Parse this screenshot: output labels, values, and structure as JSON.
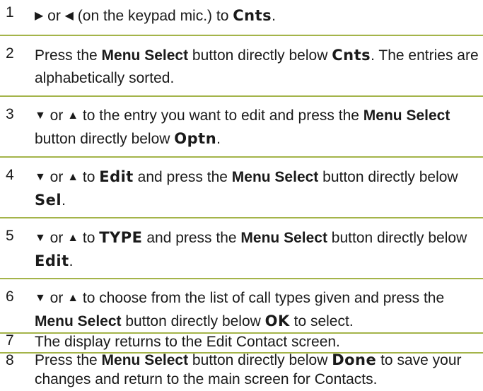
{
  "steps": [
    {
      "num": "1",
      "seg": [
        "▶",
        " or ",
        "◀",
        " (on the keypad mic.) to ",
        "Cnts",
        "."
      ]
    },
    {
      "num": "2",
      "seg": [
        "Press the ",
        "Menu Select",
        " button directly below ",
        "Cnts",
        ". The entries are alphabetically sorted."
      ]
    },
    {
      "num": "3",
      "seg": [
        "▼",
        " or ",
        "▲",
        " to the entry you want to edit and press the ",
        "Menu Select",
        " button directly below ",
        "Optn",
        "."
      ]
    },
    {
      "num": "4",
      "seg": [
        "▼",
        " or ",
        "▲",
        " to ",
        "Edit",
        " and press the ",
        "Menu Select",
        " button directly below ",
        "Sel",
        "."
      ]
    },
    {
      "num": "5",
      "seg": [
        "▼",
        " or ",
        "▲",
        " to ",
        "TYPE",
        " and press the ",
        "Menu Select",
        " button directly below ",
        "Edit",
        "."
      ]
    },
    {
      "num": "6",
      "seg": [
        "▼",
        " or ",
        "▲",
        " to choose from the list of call types given and press the ",
        "Menu Select",
        " button directly below ",
        "OK",
        " to select."
      ]
    },
    {
      "num": "7",
      "seg": [
        "The display returns to the Edit Contact screen."
      ]
    },
    {
      "num": "8",
      "seg": [
        "Press the ",
        "Menu Select",
        " button directly below ",
        "Done",
        " to save your changes and return to the main screen for Contacts."
      ]
    }
  ],
  "colors": {
    "rule": "#a4b44a",
    "text": "#1a1a1a"
  }
}
